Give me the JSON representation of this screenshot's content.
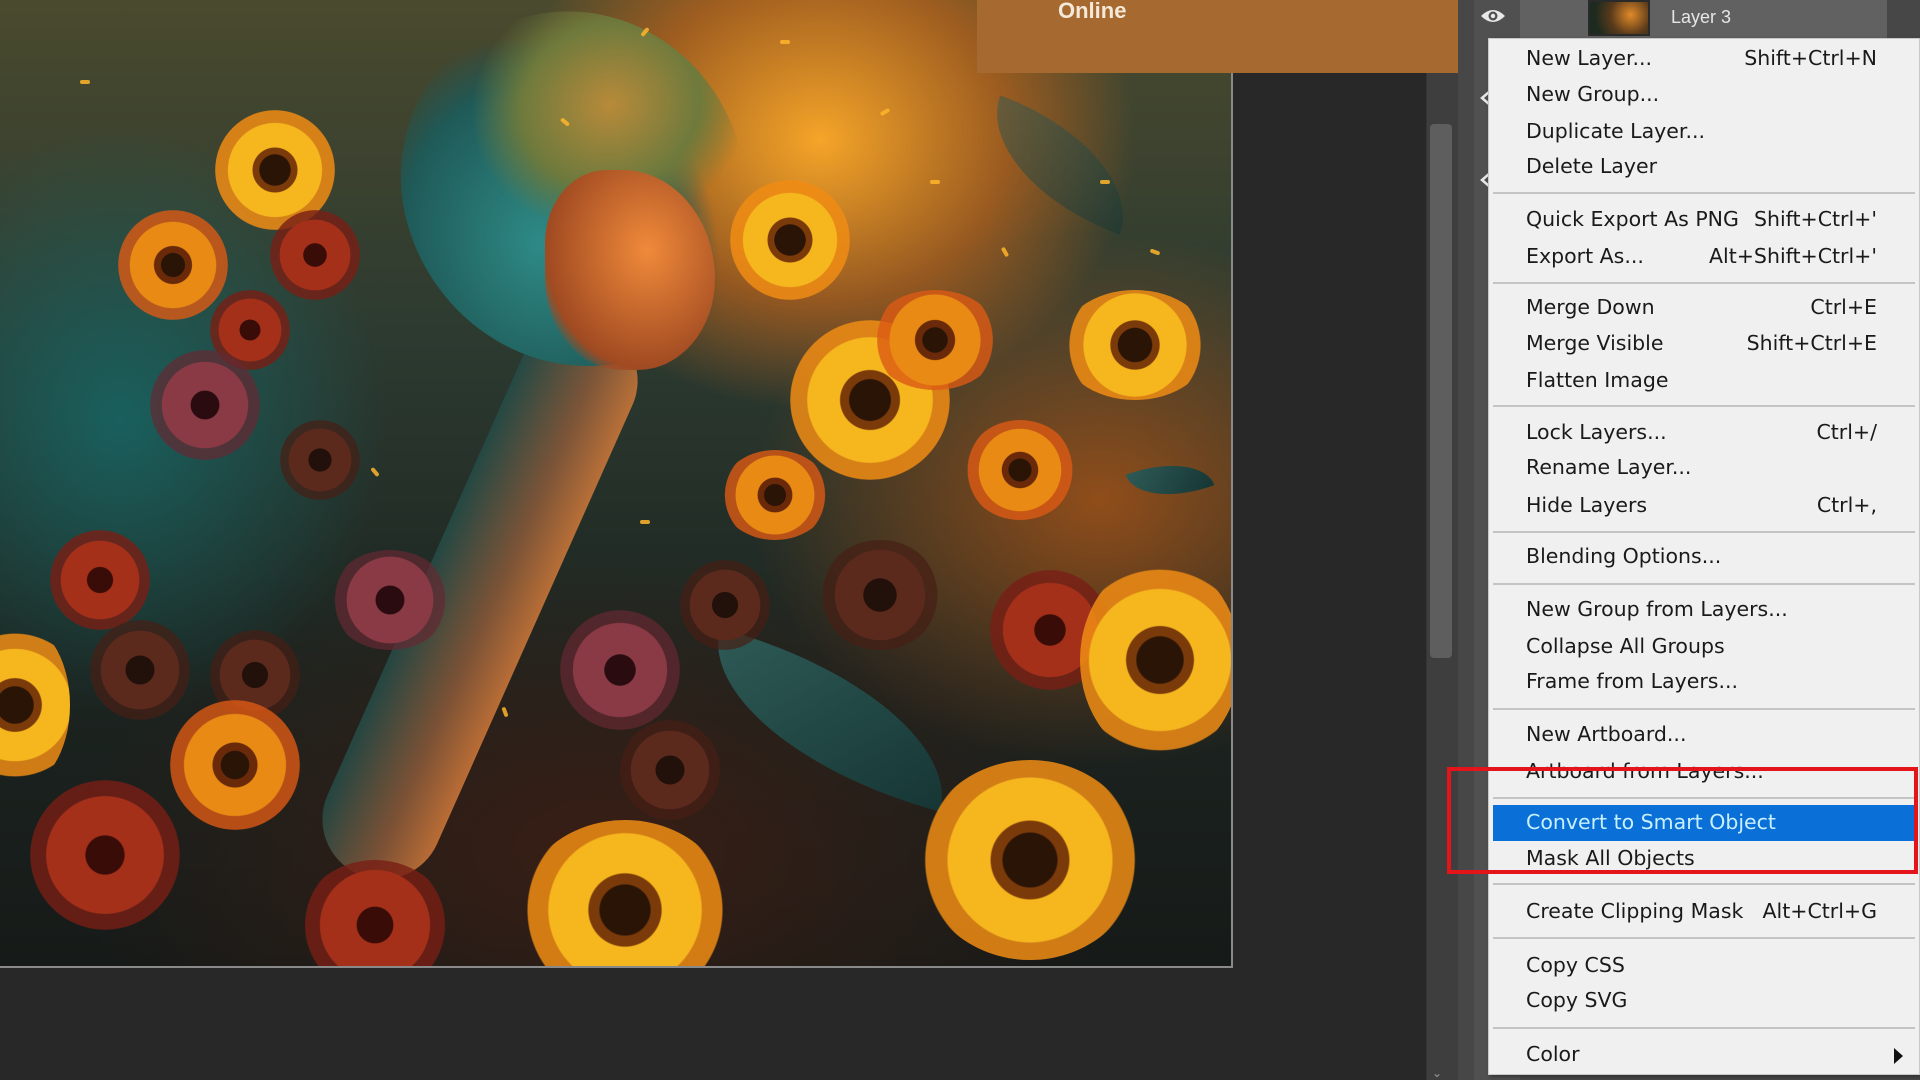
{
  "banner": {
    "text": "Online",
    "color": "#a66a30"
  },
  "layers_panel": {
    "layers": [
      {
        "name": "Layer 3",
        "visible": true
      }
    ]
  },
  "context_menu": {
    "highlight_color": "#0a6fd6",
    "items": [
      {
        "label": "New Layer...",
        "shortcut": "Shift+Ctrl+N"
      },
      {
        "label": "New Group...",
        "shortcut": ""
      },
      {
        "label": "Duplicate Layer...",
        "shortcut": ""
      },
      {
        "label": "Delete Layer",
        "shortcut": ""
      },
      {
        "label": "Quick Export As PNG",
        "shortcut": "Shift+Ctrl+'"
      },
      {
        "label": "Export As...",
        "shortcut": "Alt+Shift+Ctrl+'"
      },
      {
        "label": "Merge Down",
        "shortcut": "Ctrl+E"
      },
      {
        "label": "Merge Visible",
        "shortcut": "Shift+Ctrl+E"
      },
      {
        "label": "Flatten Image",
        "shortcut": ""
      },
      {
        "label": "Lock Layers...",
        "shortcut": "Ctrl+/"
      },
      {
        "label": "Rename Layer...",
        "shortcut": ""
      },
      {
        "label": "Hide Layers",
        "shortcut": "Ctrl+,"
      },
      {
        "label": "Blending Options...",
        "shortcut": ""
      },
      {
        "label": "New Group from Layers...",
        "shortcut": ""
      },
      {
        "label": "Collapse All Groups",
        "shortcut": ""
      },
      {
        "label": "Frame from Layers...",
        "shortcut": ""
      },
      {
        "label": "New Artboard...",
        "shortcut": ""
      },
      {
        "label": "Artboard from Layers...",
        "shortcut": ""
      },
      {
        "label": "Convert to Smart Object",
        "shortcut": "",
        "highlighted": true
      },
      {
        "label": "Mask All Objects",
        "shortcut": ""
      },
      {
        "label": "Create Clipping Mask",
        "shortcut": "Alt+Ctrl+G"
      },
      {
        "label": "Copy CSS",
        "shortcut": ""
      },
      {
        "label": "Copy SVG",
        "shortcut": ""
      },
      {
        "label": "Color",
        "shortcut": "",
        "submenu": true
      }
    ]
  },
  "annotation": {
    "color": "#e3141a",
    "targets": [
      "Convert to Smart Object",
      "Mask All Objects"
    ]
  }
}
